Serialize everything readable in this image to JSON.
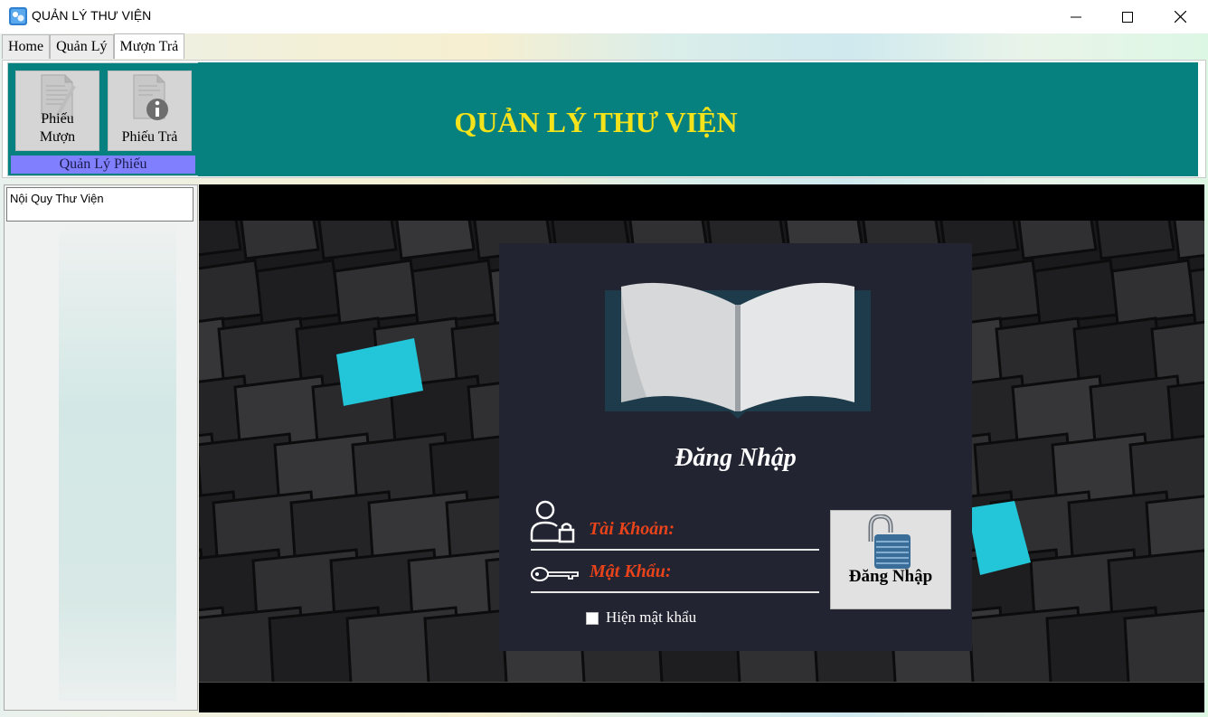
{
  "window": {
    "title": "QUẢN LÝ THƯ VIỆN",
    "icon": "app-library-icon",
    "controls": [
      "minimize-icon",
      "maximize-icon",
      "close-icon"
    ]
  },
  "tabs": [
    {
      "label": "Home",
      "active": false
    },
    {
      "label": "Quản Lý",
      "active": false
    },
    {
      "label": "Mượn Trả",
      "active": true
    }
  ],
  "ribbon": {
    "group_label": "Quản Lý Phiếu",
    "buttons": [
      {
        "label_line1": "Phiếu",
        "label_line2": "Mượn",
        "icon": "document-pen-icon"
      },
      {
        "label": "Phiếu Trả",
        "icon": "document-info-icon"
      }
    ],
    "banner_title": "QUẢN LÝ THƯ VIỆN",
    "colors": {
      "teal": "#078080",
      "group_label_bg": "#8080ff",
      "title": "#f4e21a"
    }
  },
  "left_panel": {
    "list_item": "Nội Quy Thư Viện"
  },
  "login": {
    "heading": "Đăng Nhập",
    "username_label": "Tài Khoản:",
    "username_value": "",
    "password_label": "Mật Khẩu:",
    "password_value": "",
    "show_password_label": "Hiện mật khẩu",
    "show_password_checked": false,
    "submit_label": "Đăng Nhập",
    "colors": {
      "panel": "#222431",
      "label": "#e8431a",
      "accent_cyan": "#22c6d8"
    }
  }
}
